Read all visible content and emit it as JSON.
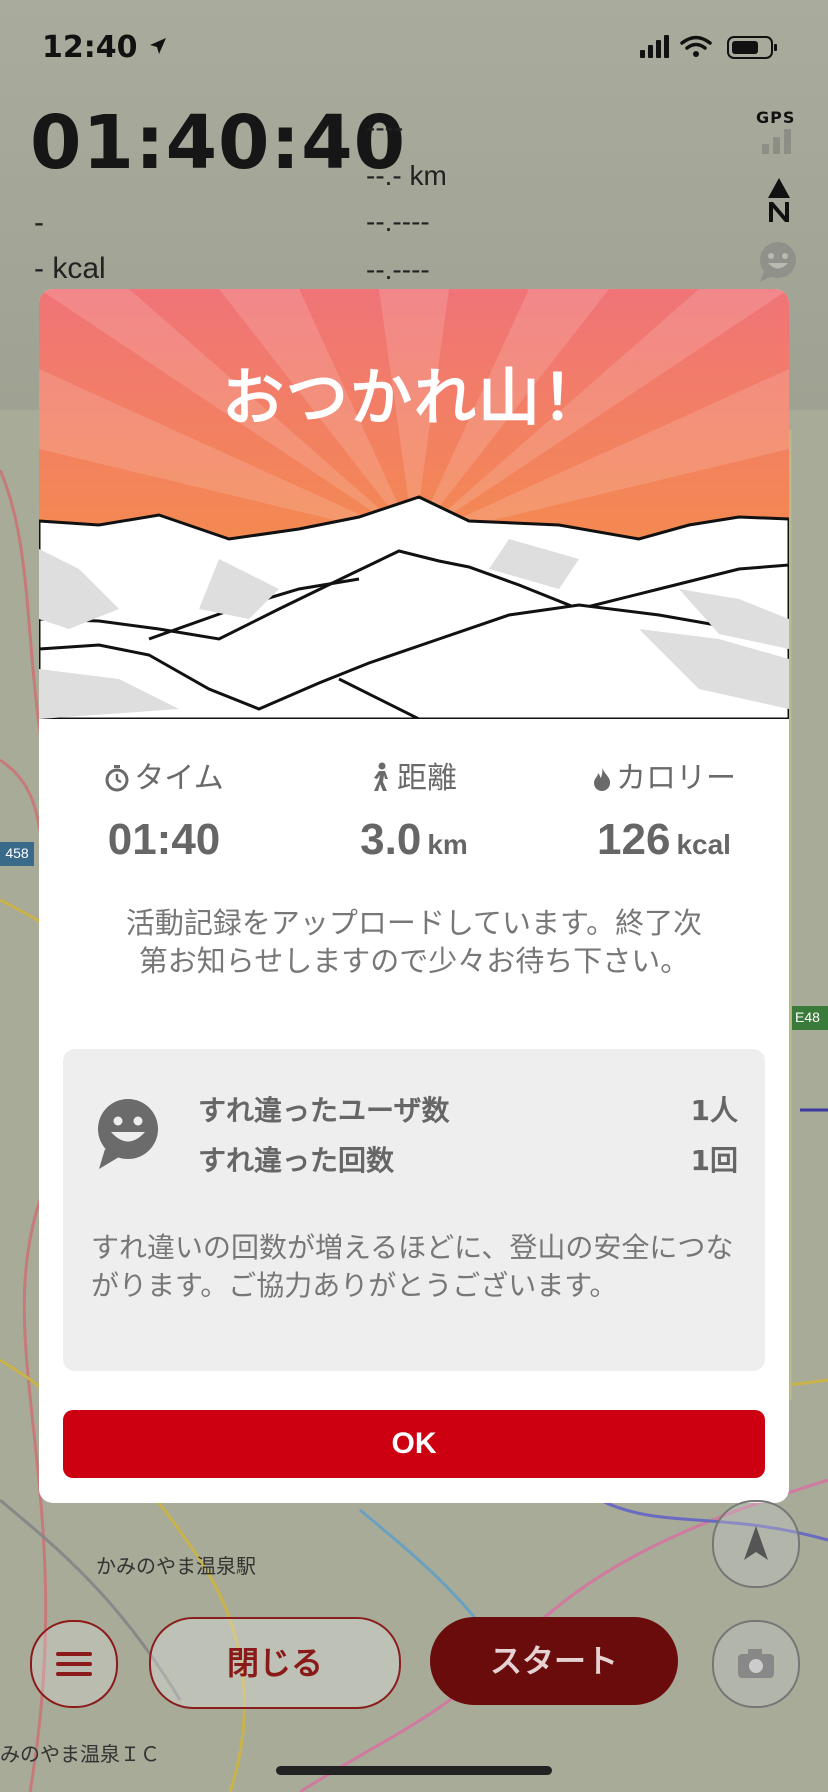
{
  "status_bar": {
    "time": "12:40"
  },
  "hud": {
    "elapsed": "01:40:40",
    "right_values": [
      "----",
      "--.- km",
      "--.----",
      "--.----"
    ],
    "left_values": [
      "-",
      "- kcal"
    ],
    "gps_label": "GPS"
  },
  "map_labels": {
    "station": "かみのやま温泉駅",
    "ic": "みのやま温泉ＩＣ",
    "route": "458",
    "expressway": "E48"
  },
  "modal": {
    "title": "おつかれ山！",
    "stats": [
      {
        "label": "タイム",
        "value": "01:40",
        "unit": ""
      },
      {
        "label": "距離",
        "value": "3.0",
        "unit": "km"
      },
      {
        "label": "カロリー",
        "value": "126",
        "unit": "kcal"
      }
    ],
    "upload_message": "活動記録をアップロードしています。終了次第お知らせしますので少々お待ち下さい。",
    "encounters": {
      "users_label": "すれ違ったユーザ数",
      "users_value": "1人",
      "count_label": "すれ違った回数",
      "count_value": "1回",
      "note": "すれ違いの回数が増えるほどに、登山の安全につながります。ご協力ありがとうございます。"
    },
    "ok_label": "OK"
  },
  "bottom_bar": {
    "close_label": "閉じる",
    "start_label": "スタート"
  },
  "colors": {
    "ok_button": "#cc0010",
    "start_button": "#6b0c0c",
    "hero_top": "#f07070",
    "hero_bottom": "#f5952a"
  }
}
